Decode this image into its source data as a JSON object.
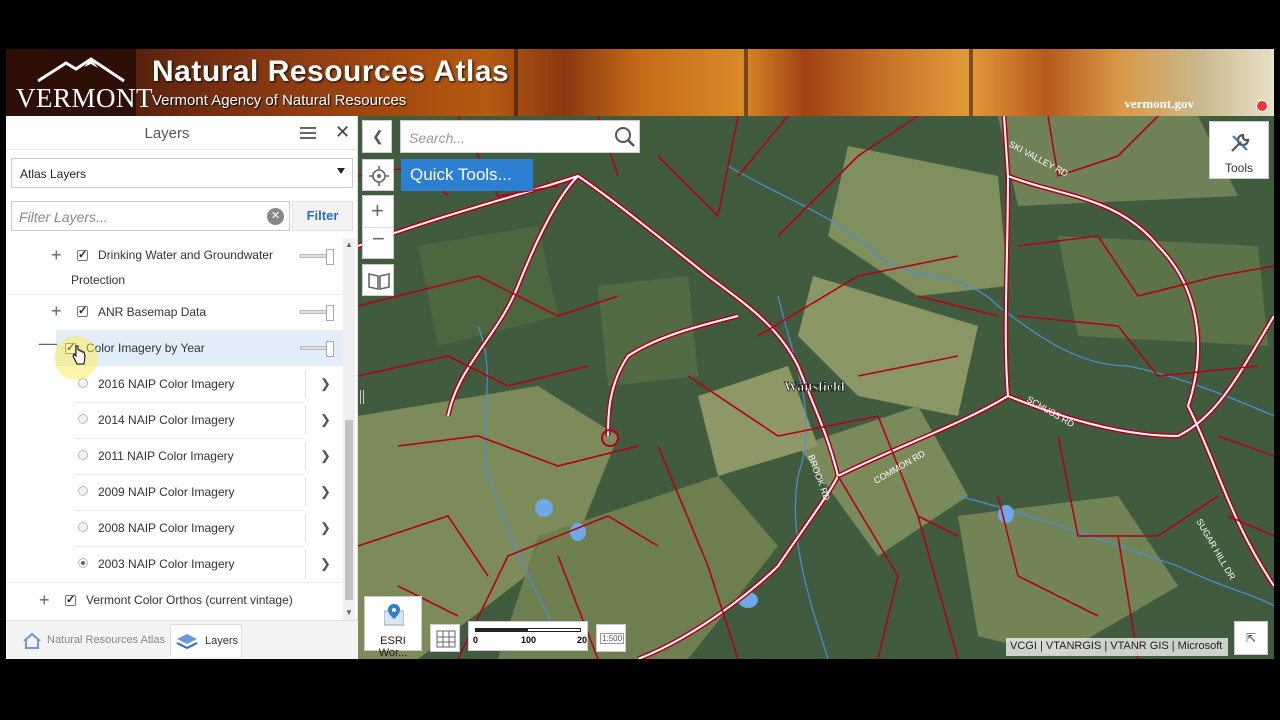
{
  "banner": {
    "state_name": "VERMONT",
    "title": "Natural Resources Atlas",
    "subtitle": "Vermont Agency of Natural Resources",
    "site": "vermont.gov"
  },
  "panel": {
    "title": "Layers",
    "dropdown_value": "Atlas Layers",
    "filter_placeholder": "Filter Layers...",
    "filter_button": "Filter",
    "layers": [
      {
        "label_line1": "Drinking Water and Groundwater",
        "label_line2": "Protection",
        "checked": true,
        "expand": "+"
      },
      {
        "label": "ANR Basemap Data",
        "checked": true,
        "expand": "+"
      },
      {
        "label": "Color Imagery by Year",
        "checked": true,
        "expand": "—"
      },
      {
        "label": "Vermont Color Orthos (current vintage)",
        "checked": true,
        "expand": "+"
      }
    ],
    "sublayers": [
      {
        "label": "2016 NAIP Color Imagery",
        "selected": false
      },
      {
        "label": "2014 NAIP Color Imagery",
        "selected": false
      },
      {
        "label": "2011 NAIP Color Imagery",
        "selected": false
      },
      {
        "label": "2009 NAIP Color Imagery",
        "selected": false
      },
      {
        "label": "2008 NAIP Color Imagery",
        "selected": false
      },
      {
        "label": "2003 NAIP Color Imagery",
        "selected": true
      }
    ],
    "tabs": {
      "atlas": "Natural Resources Atlas",
      "layers": "Layers"
    }
  },
  "map": {
    "search_placeholder": "Search...",
    "quick_tools": "Quick Tools...",
    "tools_label": "Tools",
    "place_label": "Waitsfield",
    "road_labels": [
      "SKI VALLEY RD",
      "SCHUSS RD",
      "COMMON RD",
      "BROOK RD",
      "SUGAR HILL DR"
    ],
    "basemap_label": "ESRI Wor...",
    "scale_ticks": [
      "0",
      "100",
      "20"
    ],
    "scale_text": "1:500",
    "attribution": "VCGI | VTANRGIS | VTANR GIS | Microsoft"
  },
  "colors": {
    "accent": "#2d7fd1",
    "parcel": "#b3001b",
    "stream": "#4a90d9"
  }
}
